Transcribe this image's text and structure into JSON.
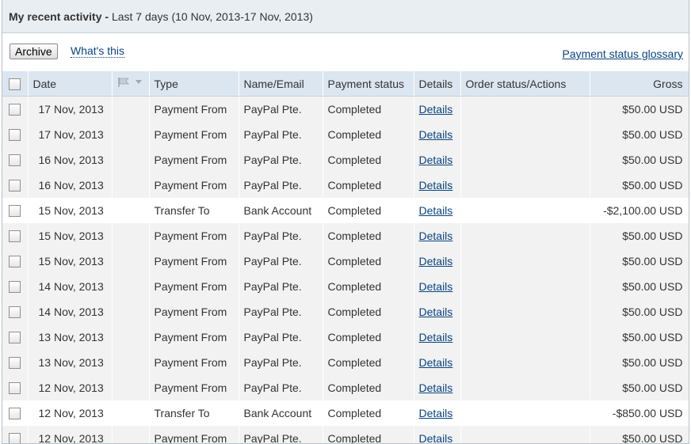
{
  "header": {
    "title": "My recent activity -",
    "range": " Last 7 days (10 Nov, 2013-17 Nov, 2013)"
  },
  "toolbar": {
    "archive_label": "Archive",
    "whats_this_label": "What's this",
    "glossary_label": "Payment status glossary"
  },
  "columns": {
    "date": "Date",
    "type": "Type",
    "name": "Name/Email",
    "status": "Payment status",
    "details": "Details",
    "order": "Order status/Actions",
    "gross": "Gross"
  },
  "rows": [
    {
      "date": "17 Nov, 2013",
      "type": "Payment From",
      "name": "PayPal Pte.",
      "status": "Completed",
      "details": "Details",
      "gross": "$50.00 USD"
    },
    {
      "date": "17 Nov, 2013",
      "type": "Payment From",
      "name": "PayPal Pte.",
      "status": "Completed",
      "details": "Details",
      "gross": "$50.00 USD"
    },
    {
      "date": "16 Nov, 2013",
      "type": "Payment From",
      "name": "PayPal Pte.",
      "status": "Completed",
      "details": "Details",
      "gross": "$50.00 USD"
    },
    {
      "date": "16 Nov, 2013",
      "type": "Payment From",
      "name": "PayPal Pte.",
      "status": "Completed",
      "details": "Details",
      "gross": "$50.00 USD"
    },
    {
      "date": "15 Nov, 2013",
      "type": "Transfer To",
      "name": "Bank Account",
      "status": "Completed",
      "details": "Details",
      "gross": "-$2,100.00 USD"
    },
    {
      "date": "15 Nov, 2013",
      "type": "Payment From",
      "name": "PayPal Pte.",
      "status": "Completed",
      "details": "Details",
      "gross": "$50.00 USD"
    },
    {
      "date": "15 Nov, 2013",
      "type": "Payment From",
      "name": "PayPal Pte.",
      "status": "Completed",
      "details": "Details",
      "gross": "$50.00 USD"
    },
    {
      "date": "14 Nov, 2013",
      "type": "Payment From",
      "name": "PayPal Pte.",
      "status": "Completed",
      "details": "Details",
      "gross": "$50.00 USD"
    },
    {
      "date": "14 Nov, 2013",
      "type": "Payment From",
      "name": "PayPal Pte.",
      "status": "Completed",
      "details": "Details",
      "gross": "$50.00 USD"
    },
    {
      "date": "13 Nov, 2013",
      "type": "Payment From",
      "name": "PayPal Pte.",
      "status": "Completed",
      "details": "Details",
      "gross": "$50.00 USD"
    },
    {
      "date": "13 Nov, 2013",
      "type": "Payment From",
      "name": "PayPal Pte.",
      "status": "Completed",
      "details": "Details",
      "gross": "$50.00 USD"
    },
    {
      "date": "12 Nov, 2013",
      "type": "Payment From",
      "name": "PayPal Pte.",
      "status": "Completed",
      "details": "Details",
      "gross": "$50.00 USD"
    },
    {
      "date": "12 Nov, 2013",
      "type": "Transfer To",
      "name": "Bank Account",
      "status": "Completed",
      "details": "Details",
      "gross": "-$850.00 USD"
    },
    {
      "date": "12 Nov, 2013",
      "type": "Payment From",
      "name": "PayPal Pte.",
      "status": "Completed",
      "details": "Details",
      "gross": "$50.00 USD"
    }
  ],
  "icons": {
    "flag_column": "flag-icon",
    "sort_caret": "caret-down-icon",
    "checkbox": "checkbox-icon"
  },
  "colors": {
    "link": "#084482",
    "header_bg": "#e9eef3",
    "column_header_bg": "#dce6f0",
    "row_bg": "#f2f2f2",
    "highlight_row_bg": "#ffffff"
  }
}
